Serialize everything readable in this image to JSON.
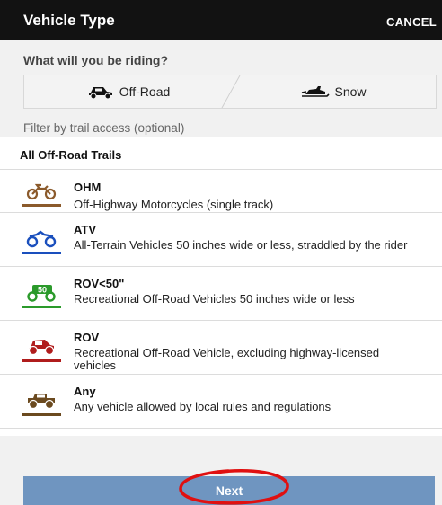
{
  "header": {
    "title": "Vehicle Type",
    "cancel_label": "CANCEL"
  },
  "prompt": {
    "question": "What will you be riding?",
    "options": [
      {
        "label": "Off-Road",
        "icon": "offroad-vehicle-icon"
      },
      {
        "label": "Snow",
        "icon": "snowmobile-icon"
      }
    ],
    "filter_label": "Filter by trail access (optional)"
  },
  "list": {
    "all_label": "All Off-Road Trails",
    "items": [
      {
        "name": "OHM",
        "desc": "Off-Highway Motorcycles (single track)",
        "color": "#8b5a2b",
        "icon": "motorcycle-icon"
      },
      {
        "name": "ATV",
        "desc": "All-Terrain Vehicles 50 inches wide or less, straddled by the rider",
        "color": "#1a4fbd",
        "icon": "atv-icon"
      },
      {
        "name": "ROV<50\"",
        "desc": "Recreational Off-Road Vehicles 50 inches wide or less",
        "color": "#2b9a2b",
        "icon": "rov-50-icon",
        "badge": "50"
      },
      {
        "name": "ROV",
        "desc": "Recreational Off-Road Vehicle, excluding highway-licensed vehicles",
        "color": "#b01c1c",
        "icon": "rov-icon"
      },
      {
        "name": "Any",
        "desc": "Any vehicle allowed by local rules and regulations",
        "color": "#6b4a1f",
        "icon": "jeep-icon"
      }
    ]
  },
  "footer": {
    "next_label": "Next"
  },
  "colors": {
    "header_bg": "#121212",
    "button_bg": "#6f95c0",
    "annotation": "#e01010"
  }
}
